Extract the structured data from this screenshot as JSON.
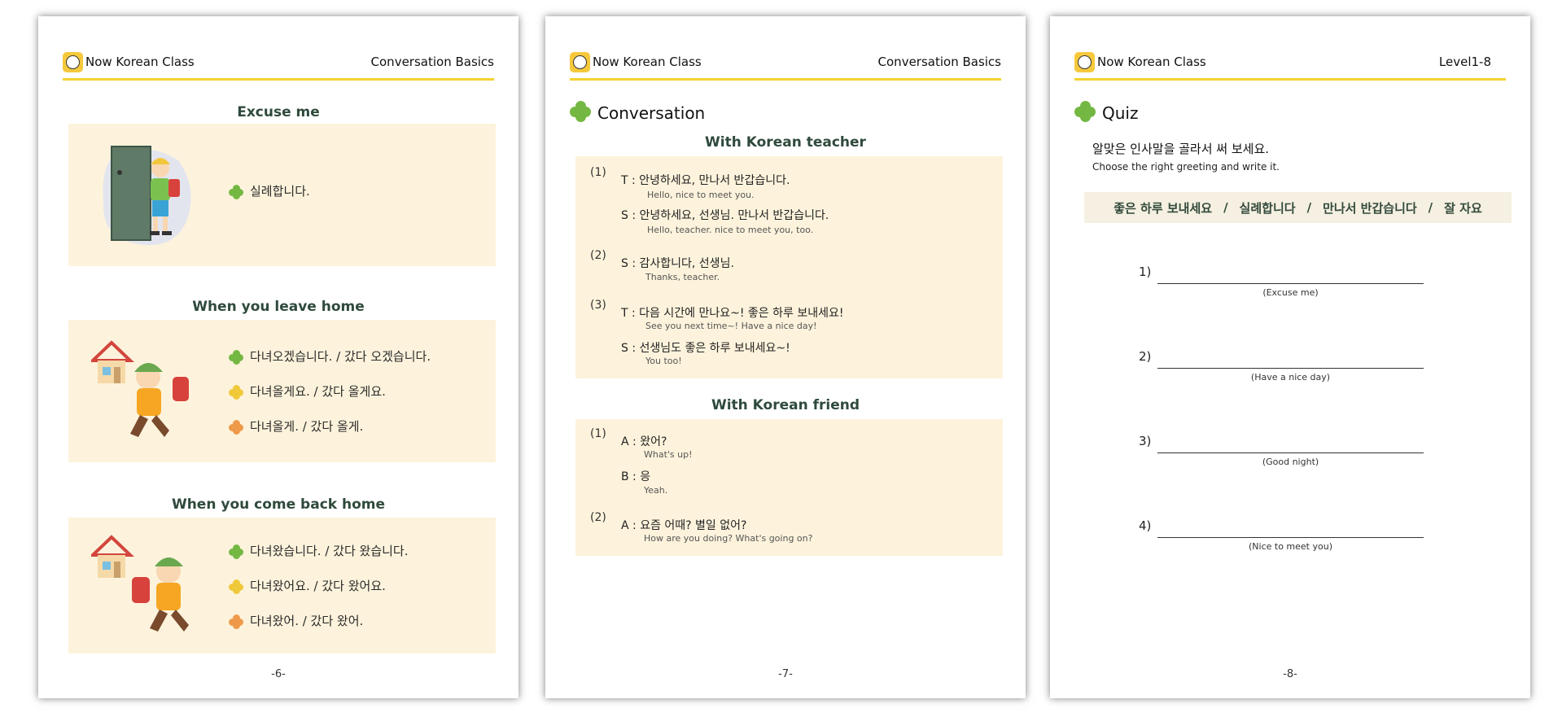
{
  "brand": "Now Korean Class",
  "pages": [
    {
      "header_right": "Conversation Basics",
      "sections": [
        {
          "title": "Excuse me",
          "phrases": [
            "실례합니다."
          ]
        },
        {
          "title": "When you leave home",
          "phrases": [
            "다녀오겠습니다. / 갔다 오겠습니다.",
            "다녀올게요. / 갔다 올게요.",
            "다녀올게. / 갔다 올게."
          ]
        },
        {
          "title": "When you come back home",
          "phrases": [
            "다녀왔습니다. / 갔다 왔습니다.",
            "다녀왔어요. / 갔다 왔어요.",
            "다녀왔어. / 갔다 왔어."
          ]
        }
      ],
      "page_number": "-6-"
    },
    {
      "header_right": "Conversation Basics",
      "heading": "Conversation",
      "teacher": {
        "title": "With Korean teacher",
        "groups": [
          {
            "num": "(1)",
            "lines": [
              {
                "text": "T : 안녕하세요, 만나서 반갑습니다.",
                "trans": "Hello, nice to meet you."
              },
              {
                "text": "S : 안녕하세요, 선생님. 만나서 반갑습니다.",
                "trans": "Hello, teacher. nice to meet you, too."
              }
            ]
          },
          {
            "num": "(2)",
            "lines": [
              {
                "text": "S : 감사합니다, 선생님.",
                "trans": "Thanks, teacher."
              }
            ]
          },
          {
            "num": "(3)",
            "lines": [
              {
                "text": "T : 다음 시간에 만나요~! 좋은 하루 보내세요!",
                "trans": "See you next time~! Have a nice day!"
              },
              {
                "text": "S : 선생님도 좋은 하루 보내세요~!",
                "trans": "You too!"
              }
            ]
          }
        ]
      },
      "friend": {
        "title": "With Korean friend",
        "groups": [
          {
            "num": "(1)",
            "lines": [
              {
                "text": "A : 왔어?",
                "trans": "What's up!"
              },
              {
                "text": "B : 응",
                "trans": "Yeah."
              }
            ]
          },
          {
            "num": "(2)",
            "lines": [
              {
                "text": "A : 요즘 어때? 별일 없어?",
                "trans": "How are you doing? What's going on?"
              }
            ]
          }
        ]
      },
      "page_number": "-7-"
    },
    {
      "header_right": "Level1-8",
      "heading": "Quiz",
      "instruction_ko": "알맞은 인사말을 골라서 써 보세요.",
      "instruction_en": "Choose the right greeting and write it.",
      "word_bank": [
        "좋은 하루 보내세요",
        "/",
        "실례합니다",
        "/",
        "만나서 반갑습니다",
        "/",
        "잘 자요"
      ],
      "questions": [
        {
          "num": "1)",
          "hint": "(Excuse me)"
        },
        {
          "num": "2)",
          "hint": "(Have a nice day)"
        },
        {
          "num": "3)",
          "hint": "(Good night)"
        },
        {
          "num": "4)",
          "hint": "(Nice to meet you)"
        }
      ],
      "page_number": "-8-"
    }
  ],
  "colors": {
    "accent_yellow": "#f5d232",
    "box_bg": "#fdf3dc",
    "clover_green": "#74b843",
    "clover_yellow": "#f0c93a",
    "clover_orange": "#ee9a4a"
  }
}
